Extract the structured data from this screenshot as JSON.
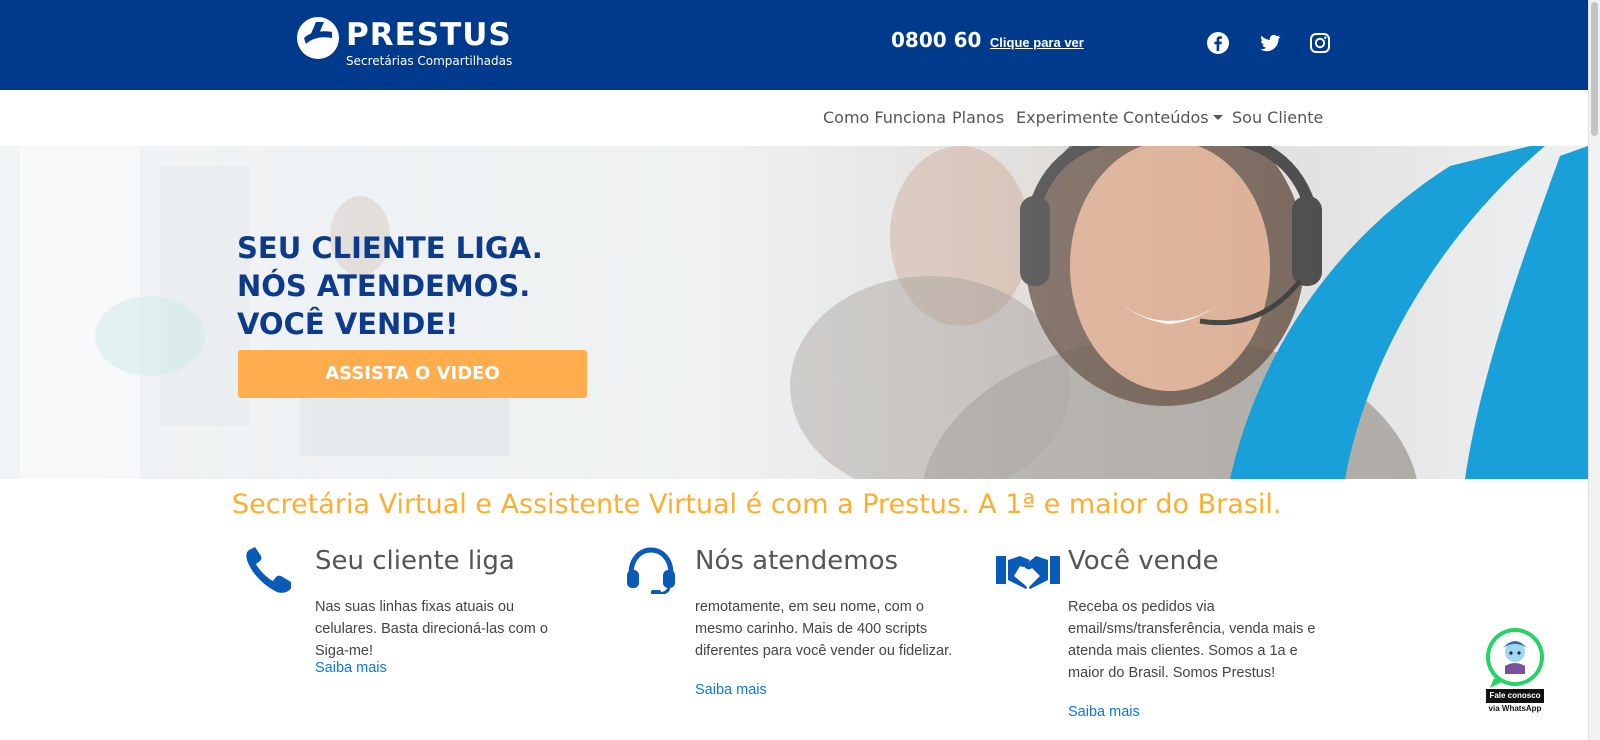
{
  "header": {
    "logo_name": "PRESTUS",
    "logo_tagline": "Secretárias Compartilhadas",
    "phone_number": "0800 60",
    "phone_reveal": "Clique para ver",
    "social_icons": [
      "facebook-icon",
      "twitter-icon",
      "instagram-icon"
    ]
  },
  "nav": {
    "items": [
      {
        "label": "Como Funciona"
      },
      {
        "label": "Planos"
      },
      {
        "label": "Experimente"
      },
      {
        "label": "Conteúdos",
        "dropdown": true
      },
      {
        "label": "Sou Cliente"
      }
    ]
  },
  "hero": {
    "lines": [
      "SEU CLIENTE LIGA.",
      "NÓS ATENDEMOS.",
      "VOCÊ VENDE!"
    ],
    "cta": "ASSISTA O VIDEO"
  },
  "tagline": "Secretária Virtual e Assistente Virtual é com a Prestus. A 1ª e maior do Brasil.",
  "features": [
    {
      "icon": "phone-icon",
      "title": "Seu cliente liga",
      "description": "Nas suas linhas fixas atuais ou celulares. Basta direcioná-las com o Siga-me!",
      "link": "Saiba mais"
    },
    {
      "icon": "headset-icon",
      "title": "Nós atendemos",
      "description": "remotamente, em seu nome, com o mesmo carinho. Mais de 400 scripts diferentes para você vender ou fidelizar.",
      "link": "Saiba mais"
    },
    {
      "icon": "handshake-icon",
      "title": "Você vende",
      "description": "Receba os pedidos via email/sms/transferência, venda mais e atenda mais clientes. Somos a 1a e maior do Brasil. Somos Prestus!",
      "link": "Saiba mais"
    }
  ],
  "whatsapp": {
    "label": "Fale conosco",
    "sublabel": "via WhatsApp",
    "icon": "whatsapp-icon"
  },
  "colors": {
    "header_bg": "#003a8c",
    "hero_title": "#0d3a8a",
    "cta_bg": "#ffad4d",
    "tagline": "#ffad2f",
    "feature_icon": "#0a5ab7",
    "link": "#0a77e8",
    "hero_swoosh": "#1aa0d8"
  }
}
